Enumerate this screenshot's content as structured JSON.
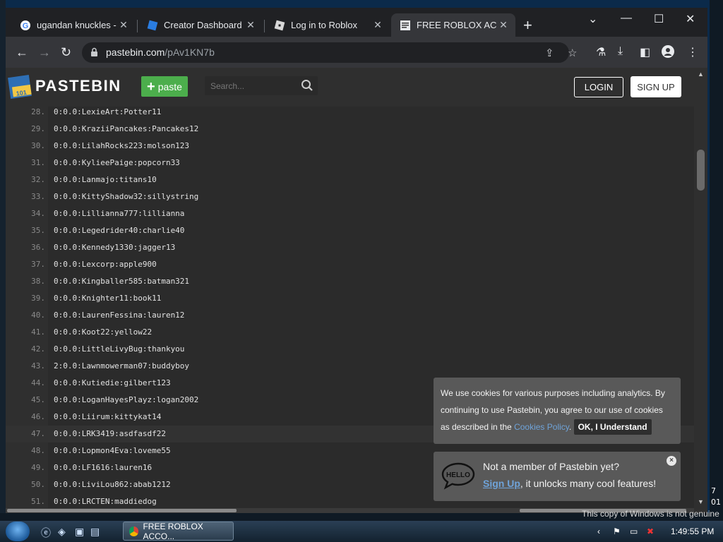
{
  "browser": {
    "tabs": [
      {
        "title": "ugandan knuckles - (",
        "active": false
      },
      {
        "title": "Creator Dashboard",
        "active": false
      },
      {
        "title": "Log in to Roblox",
        "active": false
      },
      {
        "title": "FREE ROBLOX ACCO",
        "active": true
      }
    ],
    "new_tab": "+",
    "url_host": "pastebin.com",
    "url_path": "/pAv1KN7b"
  },
  "site": {
    "logo": "PASTEBIN",
    "paste_label": "paste",
    "search_placeholder": "Search...",
    "login": "LOGIN",
    "signup": "SIGN UP"
  },
  "code": {
    "lines": [
      {
        "n": "28.",
        "t": "0:0.0:LexieArt:Potter11"
      },
      {
        "n": "29.",
        "t": "0:0.0:KraziiPancakes:Pancakes12"
      },
      {
        "n": "30.",
        "t": "0:0.0:LilahRocks223:molson123"
      },
      {
        "n": "31.",
        "t": "0:0.0:KylieePaige:popcorn33"
      },
      {
        "n": "32.",
        "t": "0:0.0:Lanmajo:titans10"
      },
      {
        "n": "33.",
        "t": "0:0.0:KittyShadow32:sillystring"
      },
      {
        "n": "34.",
        "t": "0:0.0:Lillianna777:lillianna"
      },
      {
        "n": "35.",
        "t": "0:0.0:Legedrider40:charlie40"
      },
      {
        "n": "36.",
        "t": "0:0.0:Kennedy1330:jagger13"
      },
      {
        "n": "37.",
        "t": "0:0.0:Lexcorp:apple900"
      },
      {
        "n": "38.",
        "t": "0:0.0:Kingballer585:batman321"
      },
      {
        "n": "39.",
        "t": "0:0.0:Knighter11:book11"
      },
      {
        "n": "40.",
        "t": "0:0.0:LaurenFessina:lauren12"
      },
      {
        "n": "41.",
        "t": "0:0.0:Koot22:yellow22"
      },
      {
        "n": "42.",
        "t": "0:0.0:LittleLivyBug:thankyou"
      },
      {
        "n": "43.",
        "t": "2:0.0:Lawnmowerman07:buddyboy"
      },
      {
        "n": "44.",
        "t": "0:0.0:Kutiedie:gilbert123"
      },
      {
        "n": "45.",
        "t": "0:0.0:LoganHayesPlayz:logan2002"
      },
      {
        "n": "46.",
        "t": "0:0.0:Liirum:kittykat14"
      },
      {
        "n": "47.",
        "t": "0:0.0:LRK3419:asdfasdf22"
      },
      {
        "n": "48.",
        "t": "0:0.0:Lopmon4Eva:loveme55"
      },
      {
        "n": "49.",
        "t": "0:0.0:LF1616:lauren16"
      },
      {
        "n": "50.",
        "t": "0:0.0:LiviLou862:abab1212"
      },
      {
        "n": "51.",
        "t": "0:0.0:LRCTEN:maddiedog"
      }
    ]
  },
  "cookie": {
    "text1": "We use cookies for various purposes including analytics. By continuing to use Pastebin, you agree to our use of cookies as described in the",
    "link": "Cookies Policy",
    "text2": ".",
    "ok": "OK, I Understand"
  },
  "member": {
    "line1": "Not a member of Pastebin yet?",
    "signup_link": "Sign Up",
    "line2": ", it unlocks many cool features!",
    "close": "×"
  },
  "taskbar": {
    "task_label": "FREE ROBLOX ACCO...",
    "clock": "1:49:55 PM",
    "watermark": "This copy of Windows is not genuine",
    "desktop_edge_text": "7\n01"
  }
}
